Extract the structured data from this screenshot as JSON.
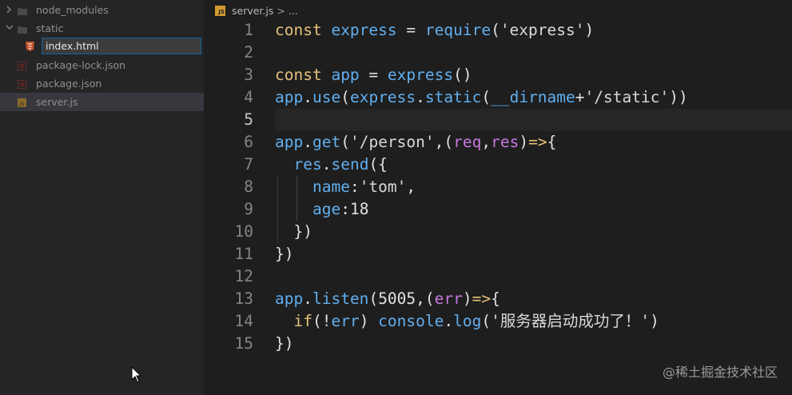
{
  "sidebar": {
    "items": [
      {
        "label": "node_modules",
        "type": "folder",
        "collapsed": true
      },
      {
        "label": "static",
        "type": "folder",
        "collapsed": false
      },
      {
        "label": "index.html",
        "type": "file",
        "icon": "html-file-icon",
        "renaming": true
      },
      {
        "label": "package-lock.json",
        "type": "file",
        "icon": "json-file-icon"
      },
      {
        "label": "package.json",
        "type": "file",
        "icon": "json-file-icon"
      },
      {
        "label": "server.js",
        "type": "file",
        "icon": "js-file-icon",
        "selected": true
      }
    ],
    "rename_value": "index.html"
  },
  "breadcrumb": {
    "file_icon_text": "JS",
    "file": "server.js",
    "separator": ">",
    "more": "..."
  },
  "editor": {
    "active_line": 5,
    "lines": [
      {
        "n": "1",
        "indent": "",
        "tokens": [
          [
            "kw",
            "const"
          ],
          [
            "pun",
            " "
          ],
          [
            "id",
            "express"
          ],
          [
            "pun",
            " = "
          ],
          [
            "id",
            "require"
          ],
          [
            "pun",
            "("
          ],
          [
            "str",
            "'express'"
          ],
          [
            "pun",
            ")"
          ]
        ]
      },
      {
        "n": "2",
        "indent": "",
        "tokens": []
      },
      {
        "n": "3",
        "indent": "",
        "tokens": [
          [
            "kw",
            "const"
          ],
          [
            "pun",
            " "
          ],
          [
            "id",
            "app"
          ],
          [
            "pun",
            " = "
          ],
          [
            "id",
            "express"
          ],
          [
            "pun",
            "()"
          ]
        ]
      },
      {
        "n": "4",
        "indent": "",
        "tokens": [
          [
            "id",
            "app"
          ],
          [
            "pun",
            "."
          ],
          [
            "id",
            "use"
          ],
          [
            "pun",
            "("
          ],
          [
            "id",
            "express"
          ],
          [
            "pun",
            "."
          ],
          [
            "id",
            "static"
          ],
          [
            "pun",
            "("
          ],
          [
            "id",
            "__dirname"
          ],
          [
            "pun",
            "+"
          ],
          [
            "str",
            "'/static'"
          ],
          [
            "pun",
            "))"
          ]
        ]
      },
      {
        "n": "5",
        "indent": "",
        "tokens": []
      },
      {
        "n": "6",
        "indent": "",
        "tokens": [
          [
            "id",
            "app"
          ],
          [
            "pun",
            "."
          ],
          [
            "id",
            "get"
          ],
          [
            "pun",
            "("
          ],
          [
            "str",
            "'/person'"
          ],
          [
            "pun",
            ",("
          ],
          [
            "op",
            "req"
          ],
          [
            "pun",
            ","
          ],
          [
            "op",
            "res"
          ],
          [
            "pun",
            ")"
          ],
          [
            "kw",
            "=>"
          ],
          [
            "pun",
            "{"
          ]
        ]
      },
      {
        "n": "7",
        "indent": "  ",
        "tokens": [
          [
            "id",
            "res"
          ],
          [
            "pun",
            "."
          ],
          [
            "id",
            "send"
          ],
          [
            "pun",
            "({"
          ]
        ]
      },
      {
        "n": "8",
        "indent": "    ",
        "tokens": [
          [
            "id",
            "name"
          ],
          [
            "pun",
            ":"
          ],
          [
            "str",
            "'tom'"
          ],
          [
            "pun",
            ","
          ]
        ]
      },
      {
        "n": "9",
        "indent": "    ",
        "tokens": [
          [
            "id",
            "age"
          ],
          [
            "pun",
            ":"
          ],
          [
            "num",
            "18"
          ]
        ]
      },
      {
        "n": "10",
        "indent": "  ",
        "tokens": [
          [
            "pun",
            "})"
          ]
        ]
      },
      {
        "n": "11",
        "indent": "",
        "tokens": [
          [
            "pun",
            "})"
          ]
        ]
      },
      {
        "n": "12",
        "indent": "",
        "tokens": []
      },
      {
        "n": "13",
        "indent": "",
        "tokens": [
          [
            "id",
            "app"
          ],
          [
            "pun",
            "."
          ],
          [
            "id",
            "listen"
          ],
          [
            "pun",
            "("
          ],
          [
            "num",
            "5005"
          ],
          [
            "pun",
            ",("
          ],
          [
            "op",
            "err"
          ],
          [
            "pun",
            ")"
          ],
          [
            "kw",
            "=>"
          ],
          [
            "pun",
            "{"
          ]
        ]
      },
      {
        "n": "14",
        "indent": "  ",
        "tokens": [
          [
            "kw",
            "if"
          ],
          [
            "pun",
            "(!"
          ],
          [
            "id",
            "err"
          ],
          [
            "pun",
            ") "
          ],
          [
            "id",
            "console"
          ],
          [
            "pun",
            "."
          ],
          [
            "id",
            "log"
          ],
          [
            "pun",
            "("
          ],
          [
            "str",
            "'服务器启动成功了！'"
          ],
          [
            "pun",
            ")"
          ]
        ]
      },
      {
        "n": "15",
        "indent": "",
        "tokens": [
          [
            "pun",
            "})"
          ]
        ]
      }
    ]
  },
  "watermark": "@稀土掘金技术社区"
}
